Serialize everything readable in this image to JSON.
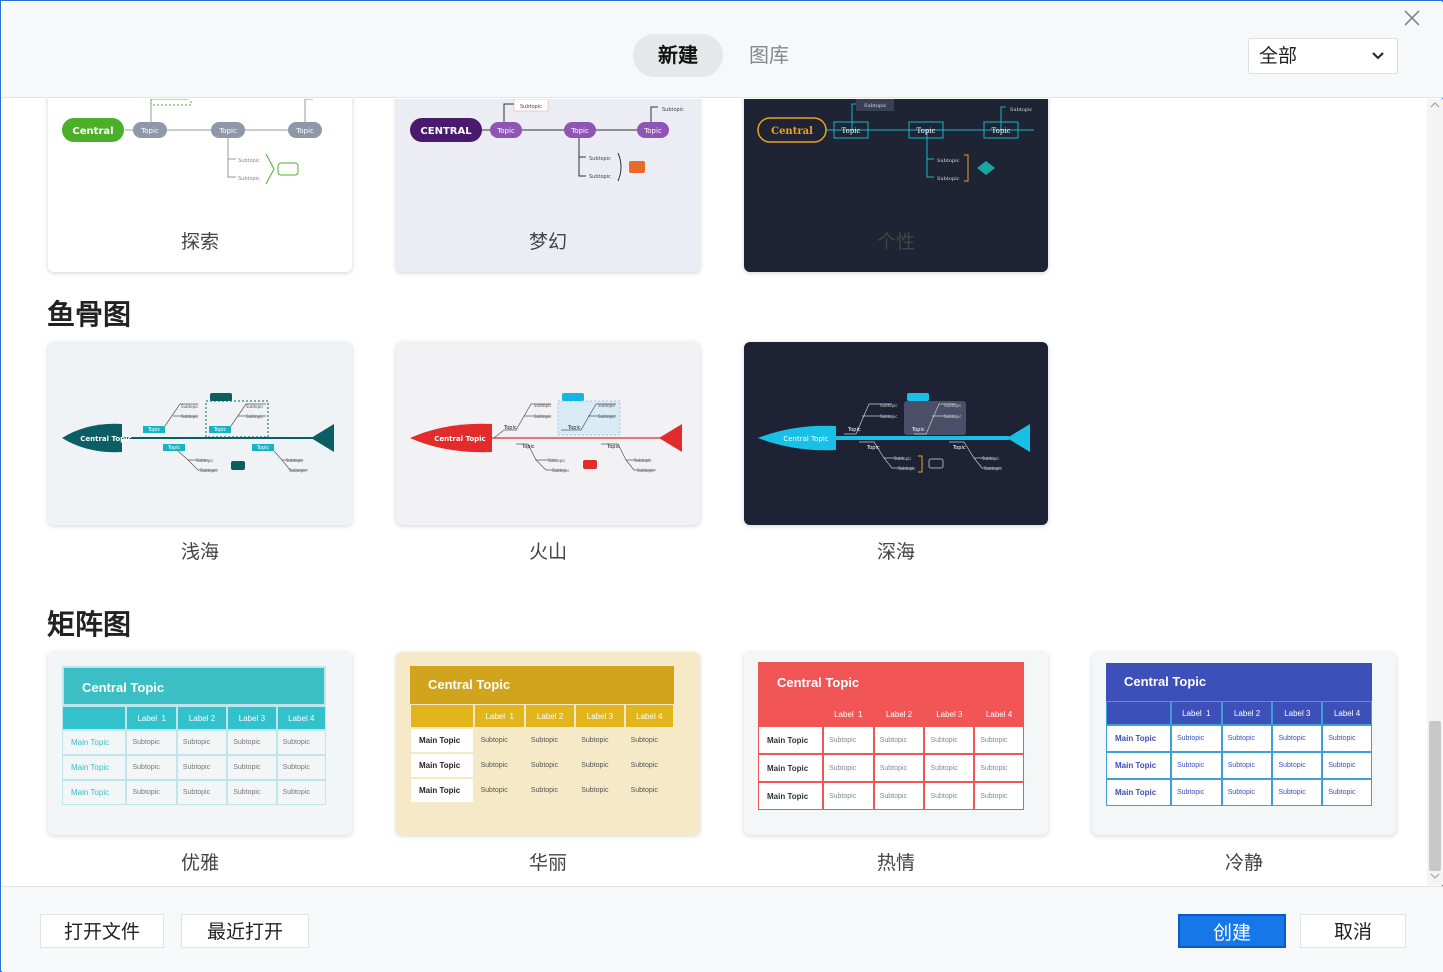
{
  "header": {
    "tabs": [
      {
        "label": "新建",
        "active": true
      },
      {
        "label": "图库",
        "active": false
      }
    ],
    "filter": {
      "selected": "全部"
    }
  },
  "sections": {
    "top_row": {
      "cards": [
        {
          "label": "探索",
          "central": "Central",
          "topic": "Topic",
          "subtopic": "Subtopic",
          "central_color": "#4caf2a"
        },
        {
          "label": "梦幻",
          "central": "CENTRAL",
          "topic": "Topic",
          "subtopic": "Subtopic",
          "central_color": "#4a1a6e"
        },
        {
          "label": "个性",
          "central": "Central",
          "topic": "Topic",
          "subtopic": "Subtopic",
          "central_color": "#f0a020"
        }
      ]
    },
    "fishbone": {
      "title": "鱼骨图",
      "cards": [
        {
          "label": "浅海",
          "central": "Central Topic",
          "topic": "Topic",
          "subtopic": "Subtopic",
          "color": "#0b5e63"
        },
        {
          "label": "火山",
          "central": "Central Topic",
          "topic": "Topic",
          "subtopic": "Subtopic",
          "color": "#e32b2b"
        },
        {
          "label": "深海",
          "central": "Central Topic",
          "topic": "Topic",
          "subtopic": "Subtopic",
          "color": "#18c0e6"
        }
      ]
    },
    "matrix": {
      "title": "矩阵图",
      "cards": [
        {
          "label": "优雅",
          "central": "Central Topic",
          "labels": [
            "Label  1",
            "Label 2",
            "Label 3",
            "Label 4"
          ],
          "row": "Main Topic",
          "cell": "Subtopic",
          "color": "#3bbfc4"
        },
        {
          "label": "华丽",
          "central": "Central Topic",
          "labels": [
            "Label  1",
            "Label 2",
            "Label 3",
            "Label 4"
          ],
          "row": "Main Topic",
          "cell": "Subtopic",
          "color": "#d0a51d"
        },
        {
          "label": "热情",
          "central": "Central Topic",
          "labels": [
            "Label  1",
            "Label 2",
            "Label 3",
            "Label 4"
          ],
          "row": "Main Topic",
          "cell": "Subtopic",
          "color": "#f25555"
        },
        {
          "label": "冷静",
          "central": "Central Topic",
          "labels": [
            "Label  1",
            "Label 2",
            "Label 3",
            "Label 4"
          ],
          "row": "Main Topic",
          "cell": "Subtopic",
          "color": "#3d4fb8"
        }
      ]
    }
  },
  "footer": {
    "open_file": "打开文件",
    "recent": "最近打开",
    "create": "创建",
    "cancel": "取消"
  }
}
